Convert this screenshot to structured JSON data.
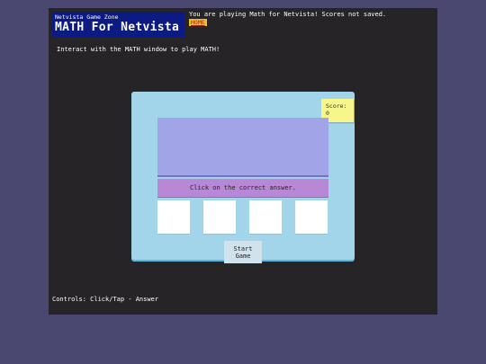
{
  "header": {
    "site_name": "Netvista Game Zone",
    "game_title": "MATH For Netvista",
    "notice": "You are playing Math for Netvista! Scores not saved.",
    "home_link": "HOME"
  },
  "instructions": "Interact with the MATH window to play MATH!",
  "game": {
    "score_label": "Score:",
    "score_value": "0",
    "question": "",
    "prompt": "Click on the correct answer.",
    "answers": [
      "",
      "",
      "",
      ""
    ],
    "start_button": {
      "line1": "Start",
      "line2": "Game"
    }
  },
  "footer": {
    "controls": "Controls: Click/Tap - Answer"
  },
  "colors": {
    "page_background": "#4a4870",
    "frame_background": "#262427",
    "logo_background": "#0c1a84",
    "game_panel": "#a2d4ea",
    "question_area": "#a2a4e8",
    "prompt_bar": "#b888d6",
    "score_box": "#f6f68a",
    "home_link_background": "#f0c020"
  }
}
